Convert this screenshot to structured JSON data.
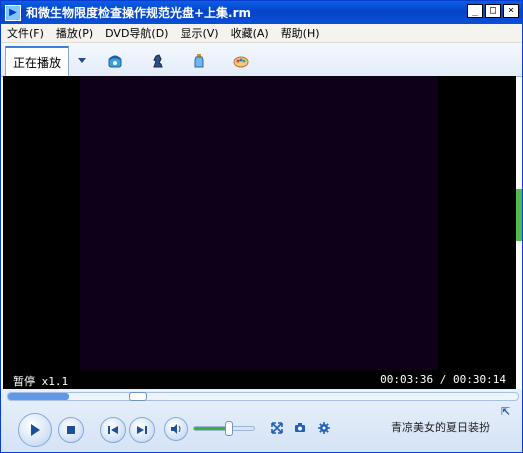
{
  "window": {
    "title": "和微生物限度检查操作规范光盘+上集.rm",
    "controls": {
      "minimize": "_",
      "maximize": "□",
      "close": "×"
    }
  },
  "menu": {
    "items": [
      "文件(F)",
      "播放(P)",
      "DVD导航(D)",
      "显示(V)",
      "收藏(A)",
      "帮助(H)"
    ]
  },
  "tabs": {
    "active_label": "正在播放",
    "icons": [
      "phone-icon",
      "chess-knight-icon",
      "bottle-icon",
      "palette-icon"
    ]
  },
  "status": {
    "state": "暂停",
    "speed": "x1.1",
    "current_time": "00:03:36",
    "total_time": "00:30:14",
    "separator": "/"
  },
  "playback": {
    "progress_fraction": 0.119,
    "volume_fraction": 0.58
  },
  "now_playing": "青凉美女的夏日装扮",
  "colors": {
    "title_bar": "#0444c8",
    "accent_green": "#52b94c",
    "video_frame": "#0d0018"
  }
}
